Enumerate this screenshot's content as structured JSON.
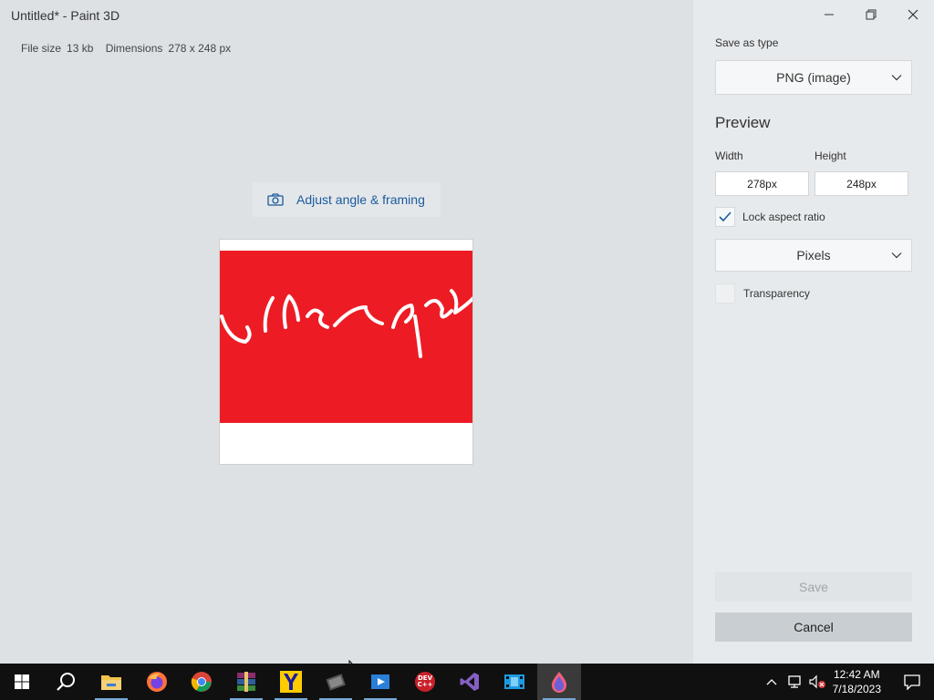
{
  "window": {
    "title": "Untitled* - Paint 3D"
  },
  "file_info": {
    "size_label": "File size",
    "size_value": "13 kb",
    "dimensions_label": "Dimensions",
    "dimensions_value": "278 x 248 px"
  },
  "canvas": {
    "adjust_button_label": "Adjust angle & framing",
    "image_bg_color": "#ffffff",
    "image_band_color": "#ed1c24"
  },
  "panel": {
    "save_as_type_label": "Save as type",
    "save_as_type_value": "PNG (image)",
    "preview_heading": "Preview",
    "width_label": "Width",
    "height_label": "Height",
    "width_value": "278px",
    "height_value": "248px",
    "lock_aspect_label": "Lock aspect ratio",
    "lock_aspect_checked": true,
    "units_value": "Pixels",
    "transparency_label": "Transparency",
    "transparency_checked": false,
    "save_label": "Save",
    "cancel_label": "Cancel"
  },
  "taskbar": {
    "apps": [
      "start-icon",
      "search-icon",
      "file-explorer-icon",
      "firefox-icon",
      "chrome-icon",
      "winrar-icon",
      "yandex-icon",
      "video-editor-icon",
      "media-player-icon",
      "devcpp-icon",
      "visual-studio-icon",
      "movies-icon",
      "paint3d-icon"
    ],
    "devcpp_label": "DEV C++",
    "time": "12:42 AM",
    "date": "7/18/2023"
  },
  "colors": {
    "accent": "#1a5a9e",
    "taskbar_bg": "#101010"
  }
}
